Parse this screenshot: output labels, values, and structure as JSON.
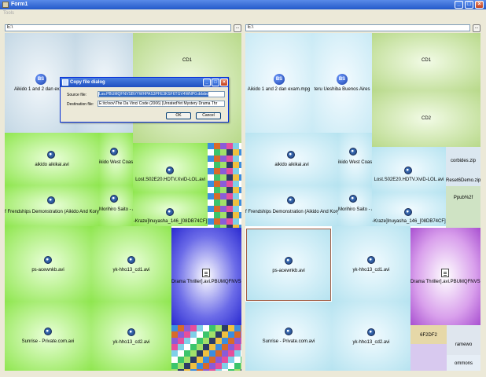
{
  "window": {
    "title": "Form1"
  },
  "menu": {
    "item": "Tools"
  },
  "left": {
    "path": "E:\\",
    "tiles": {
      "aikido_mpg": "Aikido 1 and 2 dan exam",
      "cd1": "CD1",
      "aikido_aikikai": "aikido aikikai.avi",
      "aikido_west": "ikido West Coas",
      "lost": "Lost.S02E20.HDTV.XviD-LOL.avi",
      "friendships": "f Frendships Demonstration (Aikido And Kory",
      "morihiro": "Morihiro Saito - /",
      "inuyasha": "-Kraze]Inuyasha_146_[08DB74CF]",
      "ps_acewnkb": "ps-acewnkb.avi",
      "yk_hho13_cd1": "yk-hho13_cd1.avi",
      "drama": "Drama Thriller].avi.PBUMQFNVSi",
      "sunrise": "Sunrise - Private.com.avi",
      "yk_hho13_cd2": "yk-hho13_cd2.avi"
    }
  },
  "right": {
    "path": "E:\\",
    "tiles": {
      "aikido_mpg": "Aikido 1 and 2 dan exam.mpg",
      "ueshiba": "teru Ueshiba Buenos Aires",
      "cd1": "CD1",
      "cd2": "CD2",
      "aikido_aikikai": "aikido aikikai.avi",
      "aikido_west": "ikido West Coas",
      "corbides": "corbides.zip",
      "reset": "Reset6Demo.zip",
      "lost": "Lost.S02E20.HDTV.XviD-LOL.avi",
      "pub": "Ppub%2f",
      "friendships": "f Frendships Demonstration (Aikido And Kory",
      "morihiro": "Morihiro Saito - /",
      "inuyasha": "-Kraze]Inuyasha_146_[08DB74CF]",
      "ps_acewnkb": "ps-acewnkb.avi",
      "yk_hho13_cd1": "yk-hho13_cd1.avi",
      "drama": "Drama Thriller].avi.PBUMQFNVSi",
      "sunrise": "Sunrise - Private.com.avi",
      "yk_hho13_cd2": "yk-hho13_cd2.avi",
      "bf": "6F2DF2",
      "framework": "ramewo",
      "commons": "ommons"
    }
  },
  "dialog": {
    "title": "Copy file dialog",
    "source_label": "Source file:",
    "source_value": "Lav.PBUMQFNVSBVYWHPAS3PFE3KSF6TGV4WNP0.ddsbo",
    "dest_label": "Destination file:",
    "dest_value": "E:\\tc\\nov\\The Da Vinci Code (2006) [UnratedYet Mystery Drama Thr",
    "ok_label": "OK",
    "cancel_label": "Cancel"
  },
  "icons": {
    "browse": "ellipsis",
    "file": "media-file-icon",
    "bs": "BS",
    "mosaic": "thumbnail-mosaic"
  }
}
